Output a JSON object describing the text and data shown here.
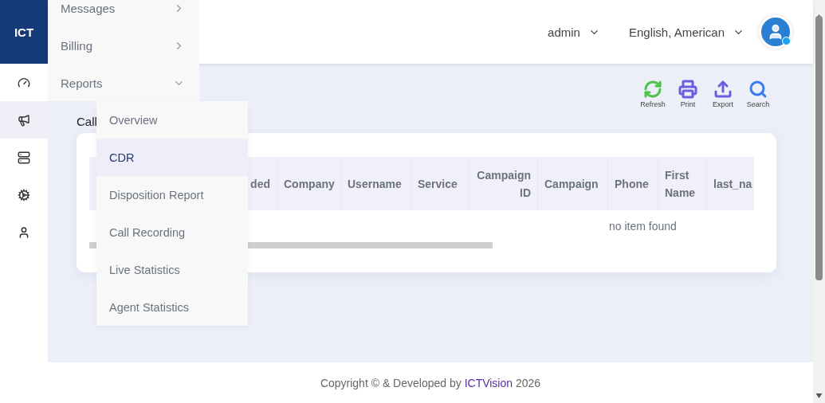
{
  "logo": "ICT",
  "rail": [
    {
      "kind": "gauge",
      "selected": false
    },
    {
      "kind": "megaphone",
      "selected": true
    },
    {
      "kind": "server",
      "selected": false
    },
    {
      "kind": "cogs",
      "selected": false
    },
    {
      "kind": "user",
      "selected": false
    }
  ],
  "header": {
    "user": "admin",
    "language": "English, American",
    "avatar": {
      "online": true
    }
  },
  "menu": [
    {
      "label": "Messages",
      "expanded": false
    },
    {
      "label": "Billing",
      "expanded": false
    },
    {
      "label": "Reports",
      "expanded": true,
      "children": [
        {
          "label": "Overview",
          "selected": false
        },
        {
          "label": "CDR",
          "selected": true
        },
        {
          "label": "Disposition Report",
          "selected": false
        },
        {
          "label": "Call Recording",
          "selected": false
        },
        {
          "label": "Live Statistics",
          "selected": false
        },
        {
          "label": "Agent Statistics",
          "selected": false
        }
      ]
    }
  ],
  "page_title": "Call",
  "toolbar": [
    {
      "kind": "refresh",
      "label": "Refresh"
    },
    {
      "kind": "print",
      "label": "Print"
    },
    {
      "kind": "export",
      "label": "Export"
    },
    {
      "kind": "search",
      "label": "Search"
    }
  ],
  "table": {
    "columns": [
      {
        "label": "ded"
      },
      {
        "label": "Company"
      },
      {
        "label": "Username"
      },
      {
        "label": "Service"
      },
      {
        "label": "Campaign ID"
      },
      {
        "label": "Campaign"
      },
      {
        "label": "Phone"
      },
      {
        "label": "First Name"
      },
      {
        "label": "last_na"
      }
    ],
    "empty_message": "no item found"
  },
  "footer": {
    "text": "Copyright © & Developed by",
    "link": "ICTVision",
    "year": "2026"
  }
}
